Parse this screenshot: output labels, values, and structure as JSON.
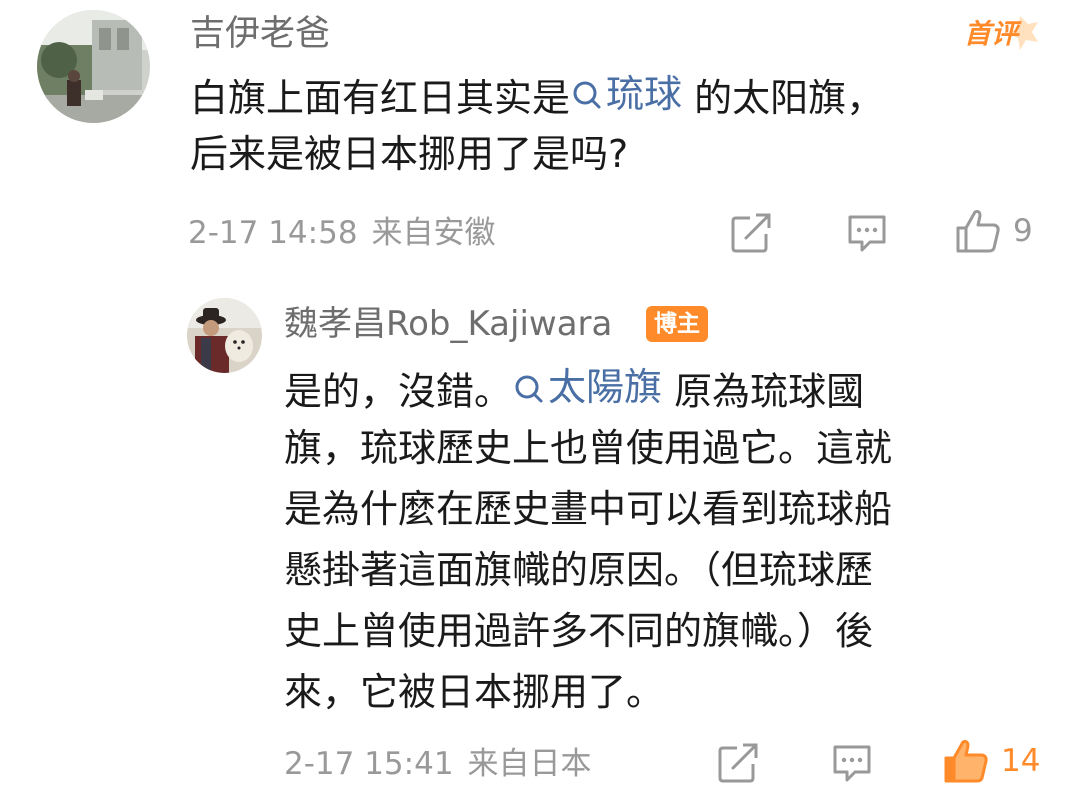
{
  "comments": [
    {
      "username": "吉伊老爸",
      "badge": "首评",
      "text_lines": [
        {
          "before": "白旗上面有红日其实是",
          "link": "琉球",
          "after": " 的太阳旗，"
        },
        {
          "before": "后来是被日本挪用了是吗?",
          "link": "",
          "after": ""
        }
      ],
      "timestamp": "2-17 14:58",
      "location": "来自安徽",
      "likes": "9"
    },
    {
      "username": "魏孝昌Rob_Kajiwara",
      "badge": "博主",
      "text_lines": [
        {
          "before": "是的，沒錯。",
          "link": "太陽旗",
          "after": " 原為琉球國"
        },
        {
          "before": "旗，琉球歷史上也曾使用過它。這就",
          "link": "",
          "after": ""
        },
        {
          "before": "是為什麼在歷史畫中可以看到琉球船",
          "link": "",
          "after": ""
        },
        {
          "before": "懸掛著這面旗幟的原因。（但琉球歷",
          "link": "",
          "after": ""
        },
        {
          "before": "史上曾使用過許多不同的旗幟。）後",
          "link": "",
          "after": ""
        },
        {
          "before": "來，它被日本挪用了。",
          "link": "",
          "after": ""
        }
      ],
      "timestamp": "2-17 15:41",
      "location": "来自日本",
      "likes": "14"
    }
  ],
  "icons": {
    "share": "share-icon",
    "reply": "comment-icon",
    "like": "thumbs-up-icon",
    "search": "search-icon"
  },
  "colors": {
    "link": "#4a6fa5",
    "meta": "#999999",
    "username": "#6e6e6e",
    "accent": "#ff8a2a"
  }
}
